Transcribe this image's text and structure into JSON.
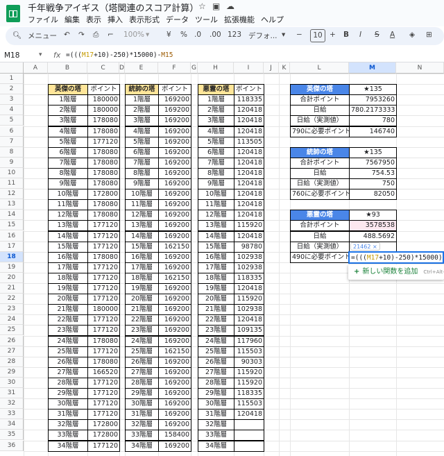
{
  "app": {
    "title": "千年戦争アイギス（塔関連のスコア計算）",
    "icons": [
      "star-icon",
      "move-to-folder-icon",
      "cloud-status-icon"
    ]
  },
  "menu": [
    "ファイル",
    "編集",
    "表示",
    "挿入",
    "表示形式",
    "データ",
    "ツール",
    "拡張機能",
    "ヘルプ"
  ],
  "toolbar": {
    "menu_search": "メニュー",
    "zoom": "100%",
    "currency": "¥",
    "percent": "%",
    "decrease_decimal": ".0",
    "increase_decimal": ".00",
    "number_format": "123",
    "font": "デフォ...",
    "font_size": "10",
    "bold": "B",
    "italic": "I",
    "strikethrough": "S",
    "text_color": "A"
  },
  "formula_bar": {
    "cell_ref": "M18",
    "fx": "fx",
    "formula_parts": [
      "=(((",
      "M17",
      "+10)-250)*15000)-",
      "M15"
    ]
  },
  "columns": [
    "A",
    "B",
    "C",
    "D",
    "E",
    "F",
    "G",
    "H",
    "I",
    "J",
    "K",
    "L",
    "M",
    "N"
  ],
  "active_column": "M",
  "rows": [
    "1",
    "2",
    "3",
    "4",
    "5",
    "6",
    "7",
    "8",
    "9",
    "10",
    "11",
    "12",
    "13",
    "14",
    "15",
    "16",
    "17",
    "18",
    "19",
    "20",
    "21",
    "22",
    "23",
    "24",
    "25",
    "26",
    "27",
    "28",
    "29",
    "30",
    "31",
    "32",
    "33",
    "34",
    "35",
    "36"
  ],
  "active_row": "18",
  "tower1": {
    "header": [
      "英傑の塔",
      "ポイント"
    ],
    "floors": [
      "1階層",
      "2階層",
      "3階層",
      "4階層",
      "5階層",
      "6階層",
      "7階層",
      "8階層",
      "9階層",
      "10階層",
      "11階層",
      "12階層",
      "13階層",
      "14階層",
      "15階層",
      "16階層",
      "17階層",
      "18階層",
      "19階層",
      "20階層",
      "21階層",
      "22階層",
      "23階層",
      "24階層",
      "25階層",
      "26階層",
      "27階層",
      "28階層",
      "29階層",
      "30階層",
      "31階層",
      "32階層",
      "33階層",
      "34階層"
    ],
    "points": [
      "180000",
      "180000",
      "178080",
      "178080",
      "177120",
      "178080",
      "178080",
      "178080",
      "178080",
      "172800",
      "178080",
      "178080",
      "177120",
      "177120",
      "177120",
      "178080",
      "177120",
      "177120",
      "177120",
      "177120",
      "180000",
      "177120",
      "177120",
      "178080",
      "177120",
      "178080",
      "166520",
      "177120",
      "177120",
      "177120",
      "177120",
      "172800",
      "172800",
      "177120"
    ]
  },
  "tower2": {
    "header": [
      "統帥の塔",
      "ポイント"
    ],
    "floors": [
      "1階層",
      "2階層",
      "3階層",
      "4階層",
      "5階層",
      "6階層",
      "7階層",
      "8階層",
      "9階層",
      "10階層",
      "11階層",
      "12階層",
      "13階層",
      "14階層",
      "15階層",
      "16階層",
      "17階層",
      "18階層",
      "19階層",
      "20階層",
      "21階層",
      "22階層",
      "23階層",
      "24階層",
      "25階層",
      "26階層",
      "27階層",
      "28階層",
      "29階層",
      "30階層",
      "31階層",
      "32階層",
      "33階層",
      "34階層"
    ],
    "points": [
      "169200",
      "169200",
      "169200",
      "169200",
      "169200",
      "169200",
      "169200",
      "169200",
      "169200",
      "169200",
      "169200",
      "169200",
      "169200",
      "169200",
      "162150",
      "169200",
      "169200",
      "162150",
      "169200",
      "169200",
      "169200",
      "169200",
      "169200",
      "169200",
      "162150",
      "169200",
      "169200",
      "169200",
      "169200",
      "169200",
      "169200",
      "169200",
      "158400",
      "169200"
    ]
  },
  "tower3": {
    "header": [
      "悪霊の塔",
      "ポイント"
    ],
    "floors": [
      "1階層",
      "2階層",
      "3階層",
      "4階層",
      "5階層",
      "6階層",
      "7階層",
      "8階層",
      "9階層",
      "10階層",
      "11階層",
      "12階層",
      "13階層",
      "14階層",
      "15階層",
      "16階層",
      "17階層",
      "18階層",
      "19階層",
      "20階層",
      "21階層",
      "22階層",
      "23階層",
      "24階層",
      "25階層",
      "26階層",
      "27階層",
      "28階層",
      "29階層",
      "30階層",
      "31階層",
      "32階層",
      "33階層",
      "34階層"
    ],
    "points": [
      "118335",
      "120418",
      "120418",
      "120418",
      "113505",
      "120418",
      "120418",
      "120418",
      "120418",
      "120418",
      "120418",
      "120418",
      "115920",
      "120418",
      "98780",
      "102938",
      "102938",
      "118335",
      "120418",
      "115920",
      "102938",
      "120418",
      "109135",
      "117960",
      "115503",
      "90303",
      "115920",
      "115920",
      "118335",
      "115503",
      "120418",
      "",
      "",
      ""
    ]
  },
  "summary1": {
    "title": "英傑の塔",
    "rank": "★135",
    "rows": [
      [
        "合計ポイント",
        "7953260"
      ],
      [
        "日給",
        "780.2173333"
      ],
      [
        "日給（実測値）",
        "780"
      ],
      [
        "790に必要ポイント",
        "146740"
      ]
    ]
  },
  "summary2": {
    "title": "統帥の塔",
    "rank": "★135",
    "rows": [
      [
        "合計ポイント",
        "7567950"
      ],
      [
        "日給",
        "754.53"
      ],
      [
        "日給（実測値）",
        "750"
      ],
      [
        "760に必要ポイント",
        "82050"
      ]
    ]
  },
  "summary3": {
    "title": "悪霊の塔",
    "rank": "★93",
    "rows": [
      [
        "合計ポイント",
        "3578538"
      ],
      [
        "日給",
        "488.5692"
      ],
      [
        "日給（実測値）",
        ""
      ],
      [
        "490に必要ポイント",
        ""
      ]
    ]
  },
  "edit_tooltip": "21462 ×",
  "autocomplete": {
    "label": "新しい関数を追加",
    "shortcut": "Ctrl+Alt+"
  },
  "colors": {
    "header_yellow": "#ffe599",
    "summary_blue": "#4a86e8",
    "selection": "#1a73e8",
    "sheets_green": "#0f9d58"
  }
}
